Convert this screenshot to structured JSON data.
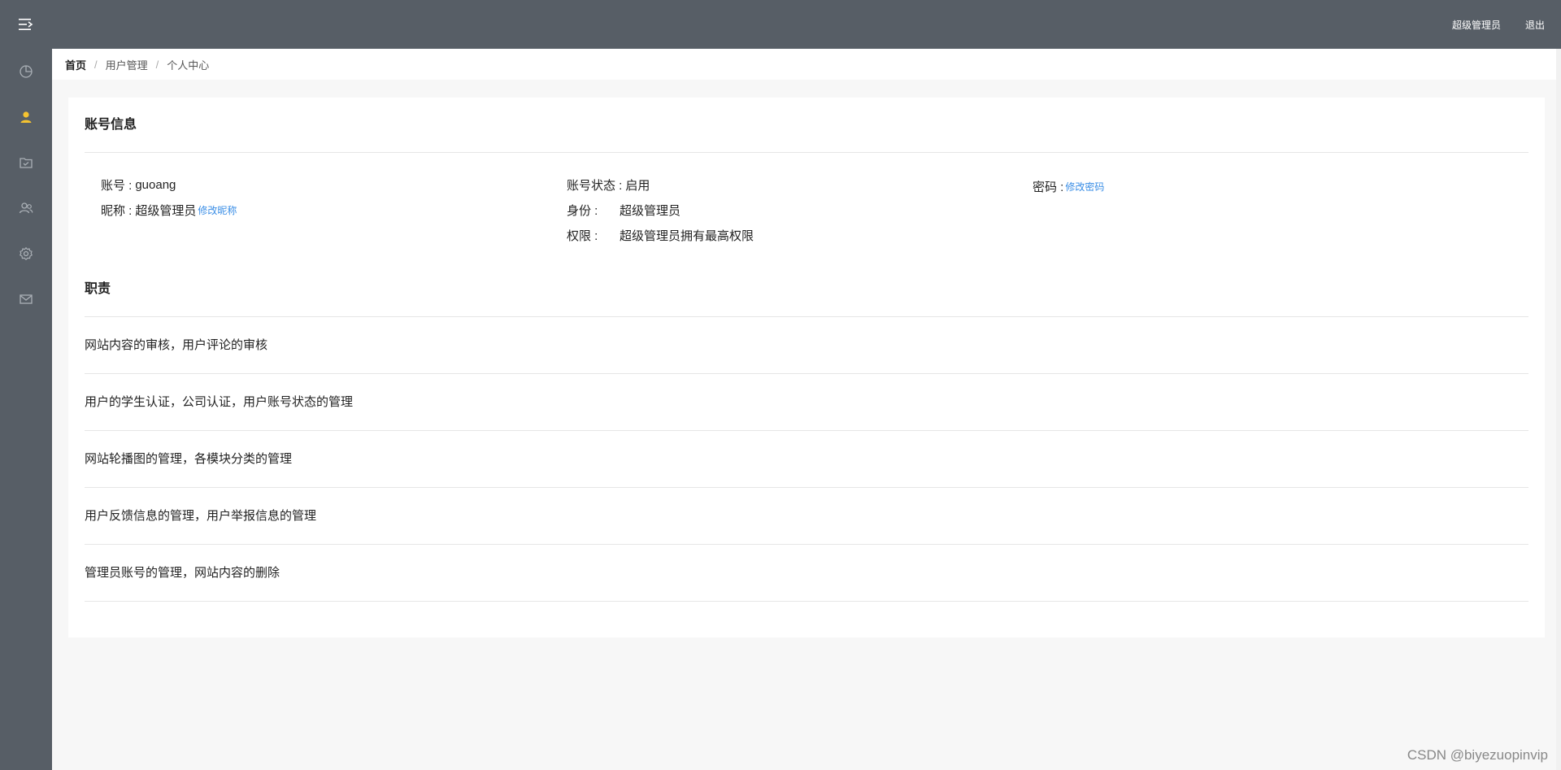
{
  "header": {
    "user_role": "超级管理员",
    "logout_label": "退出"
  },
  "sidebar": {
    "items": [
      {
        "icon": "dashboard-icon"
      },
      {
        "icon": "user-icon",
        "active": true
      },
      {
        "icon": "folder-icon"
      },
      {
        "icon": "users-icon"
      },
      {
        "icon": "gear-icon"
      },
      {
        "icon": "mail-icon"
      }
    ],
    "active_color": "#f5c330"
  },
  "breadcrumb": [
    "首页",
    "用户管理",
    "个人中心"
  ],
  "account": {
    "title": "账号信息",
    "username_label": "账号 :",
    "username": "guoang",
    "nickname_label": "昵称 :",
    "nickname": "超级管理员",
    "edit_nickname": "修改昵称",
    "status_label": "账号状态 :",
    "status": "启用",
    "identity_label": "身份 :",
    "identity": "超级管理员",
    "permission_label": "权限 :",
    "permission": "超级管理员拥有最高权限",
    "password_label": "密码 :",
    "edit_password": "修改密码"
  },
  "duties": {
    "title": "职责",
    "items": [
      "网站内容的审核，用户评论的审核",
      "用户的学生认证，公司认证，用户账号状态的管理",
      "网站轮播图的管理，各模块分类的管理",
      "用户反馈信息的管理，用户举报信息的管理",
      "管理员账号的管理，网站内容的删除"
    ]
  },
  "watermark": "CSDN @biyezuopinvip",
  "colors": {
    "header_bg": "#575e66",
    "link": "#3a8ee6"
  }
}
